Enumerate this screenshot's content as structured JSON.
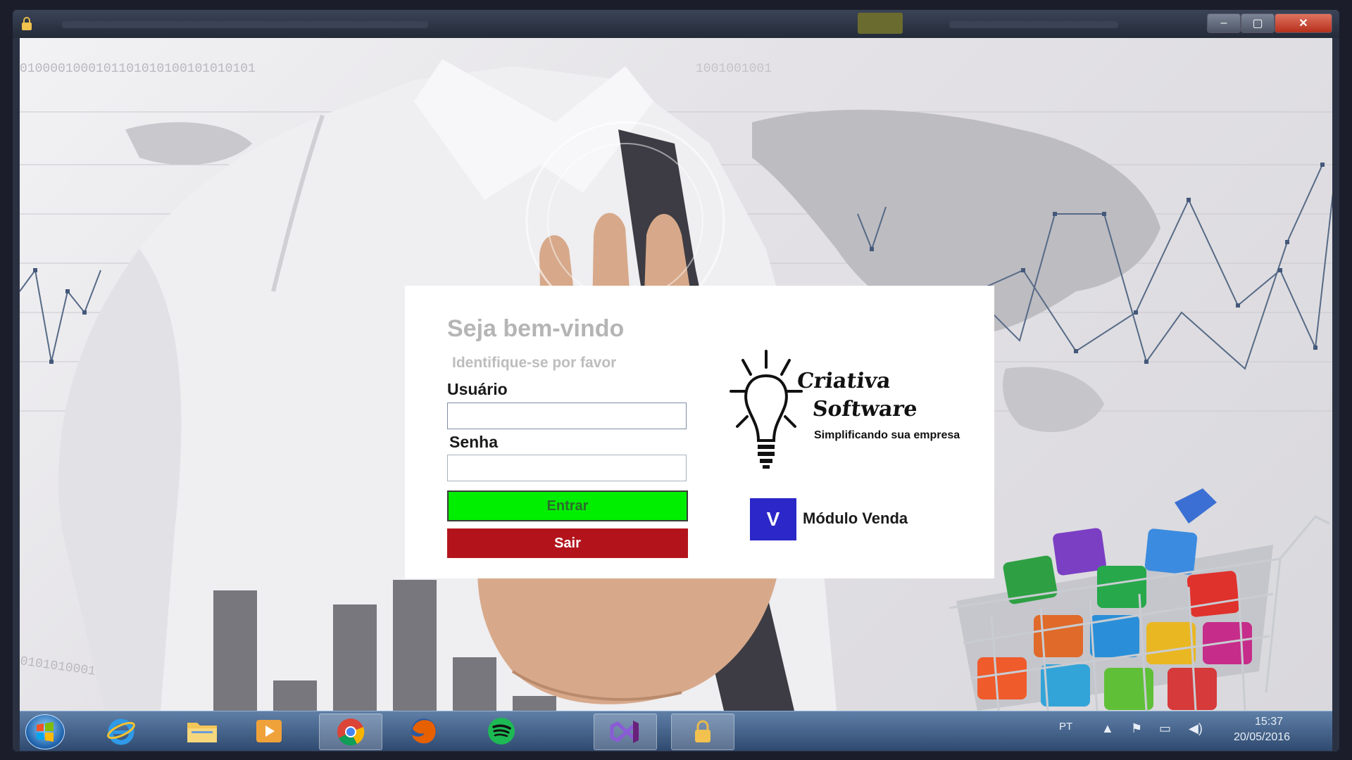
{
  "login": {
    "welcome": "Seja bem-vindo",
    "subtitle": "Identifique-se por favor",
    "user_label": "Usuário",
    "user_value": "",
    "password_label": "Senha",
    "password_value": "",
    "enter_button": "Entrar",
    "exit_button": "Sair"
  },
  "brand": {
    "line1": "Criativa",
    "line2": "Software",
    "tagline": "Simplificando sua empresa"
  },
  "module": {
    "badge": "V",
    "label": "Módulo Venda"
  },
  "window": {
    "close_glyph": "✕",
    "max_glyph": "▢",
    "min_glyph": "–"
  },
  "taskbar": {
    "items": [
      "windows-start",
      "internet-explorer",
      "file-explorer",
      "media-player",
      "chrome",
      "firefox",
      "spotify",
      "visual-studio",
      "app-lock"
    ],
    "language": "PT",
    "time": "15:37",
    "date": "20/05/2016"
  },
  "colors": {
    "enter": "#00ee00",
    "exit": "#b3141c",
    "module_badge": "#2b27c8"
  }
}
